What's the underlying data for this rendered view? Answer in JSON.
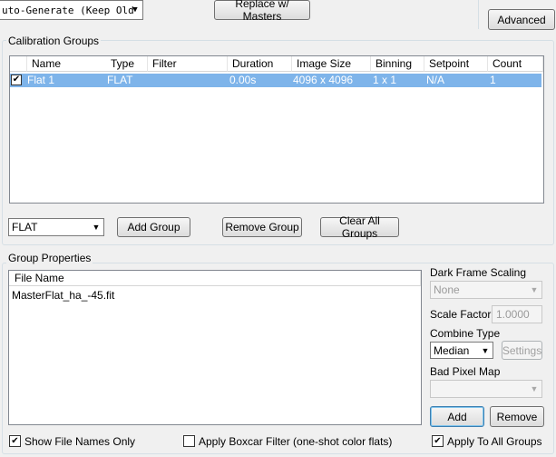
{
  "top": {
    "auto_generate_select": "uto-Generate (Keep Old",
    "replace_masters_label": "Replace w/ Masters",
    "advanced_label": "Advanced"
  },
  "calibration": {
    "group_title": "Calibration Groups",
    "columns": [
      "Name",
      "Type",
      "Filter",
      "Duration",
      "Image Size",
      "Binning",
      "Setpoint",
      "Count"
    ],
    "rows": [
      {
        "checked": true,
        "cells": [
          "Flat 1",
          "FLAT",
          "",
          "0.00s",
          "4096 x 4096",
          "1 x 1",
          "N/A",
          "1"
        ]
      }
    ],
    "type_select": "FLAT",
    "add_group_label": "Add Group",
    "remove_group_label": "Remove Group",
    "clear_all_label": "Clear All Groups"
  },
  "properties": {
    "group_title": "Group Properties",
    "file_column": "File Name",
    "files": [
      "MasterFlat_ha_-45.fit"
    ],
    "dark_scaling_label": "Dark Frame Scaling",
    "dark_scaling_value": "None",
    "scale_factor_label": "Scale Factor",
    "scale_factor_value": "1.0000",
    "combine_type_label": "Combine Type",
    "combine_type_value": "Median",
    "settings_label": "Settings",
    "bad_pixel_label": "Bad Pixel Map",
    "bad_pixel_value": "",
    "add_label": "Add",
    "remove_label": "Remove"
  },
  "bottom": {
    "show_file_names_label": "Show File Names Only",
    "show_file_names_checked": true,
    "boxcar_label": "Apply Boxcar Filter (one-shot color flats)",
    "boxcar_checked": false,
    "apply_all_label": "Apply To All Groups",
    "apply_all_checked": true
  },
  "colors": {
    "selection": "#7eb4ea",
    "group_border": "#d5dfe5"
  }
}
